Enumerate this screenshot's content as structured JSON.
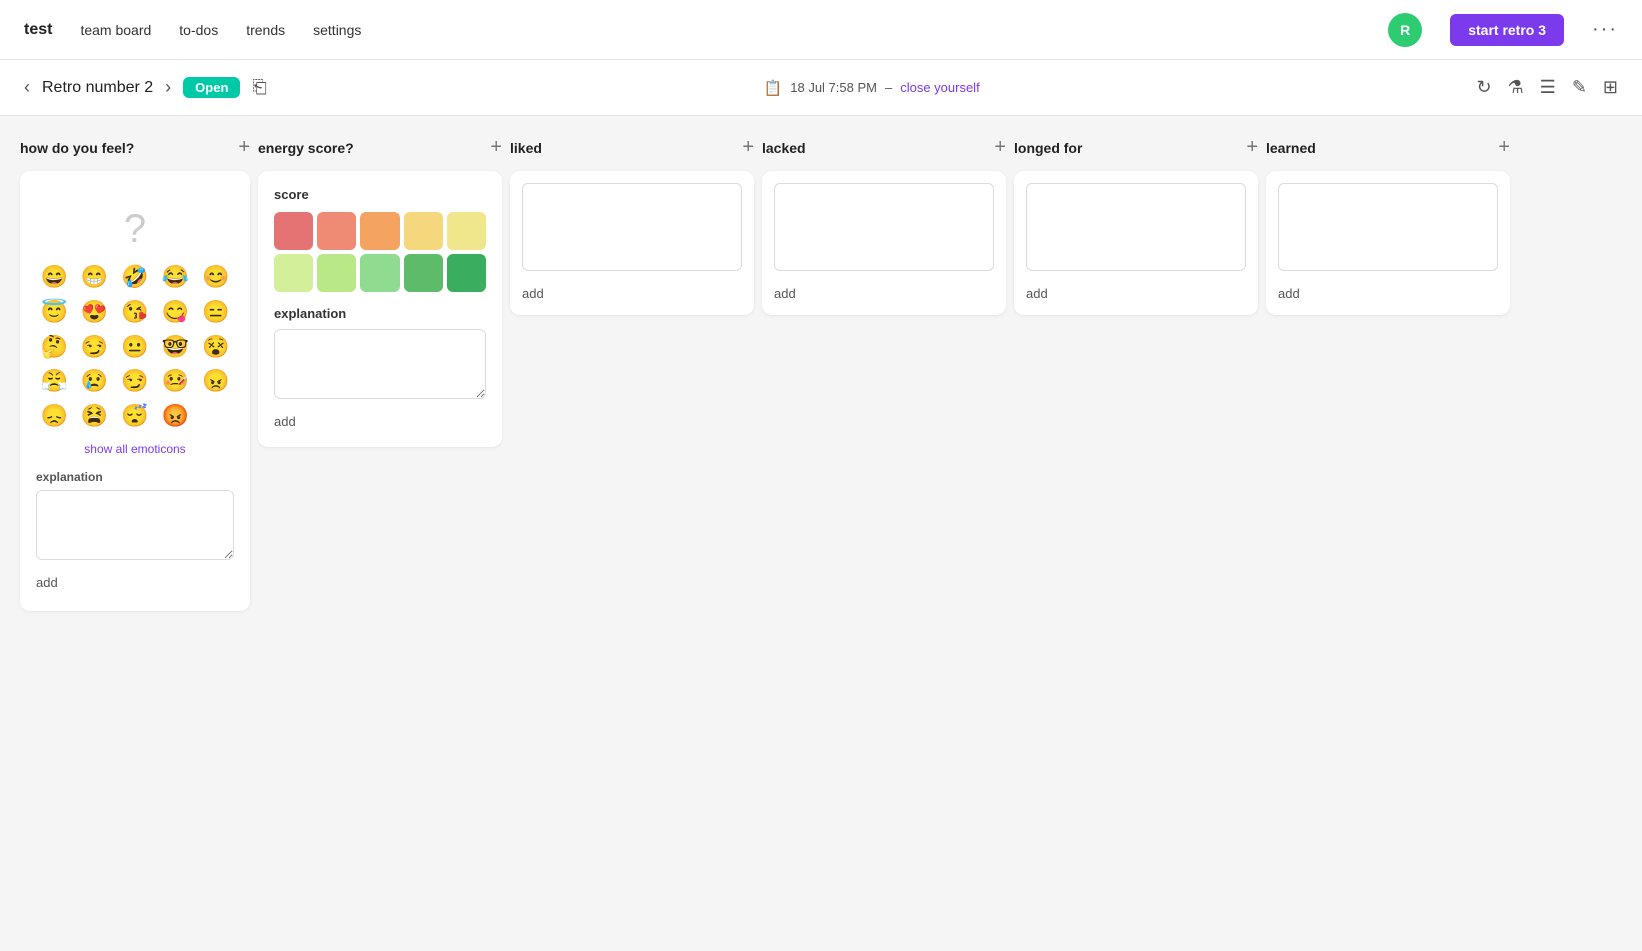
{
  "app": {
    "logo": "test",
    "nav_items": [
      "team board",
      "to-dos",
      "trends",
      "settings"
    ],
    "avatar_letter": "R",
    "start_retro_label": "start retro 3",
    "more_label": "···"
  },
  "sub_nav": {
    "retro_title": "Retro number 2",
    "open_label": "Open",
    "datetime": "18 Jul 7:58 PM",
    "close_label": "close yourself"
  },
  "columns": [
    {
      "id": "feel",
      "title": "how do you feel?",
      "show_all_label": "show all emoticons",
      "explanation_label": "explanation",
      "add_label": "add",
      "emojis": [
        "😄",
        "😁",
        "🤣",
        "😂",
        "😊",
        "😇",
        "😍",
        "😘",
        "😋",
        "😑",
        "🤔",
        "😏",
        "😐",
        "🤓",
        "😵",
        "😤",
        "😢",
        "😏",
        "🤒",
        "😠",
        "😞",
        "😫",
        "😴",
        "😡"
      ]
    },
    {
      "id": "energy",
      "title": "energy score?",
      "score_label": "score",
      "score_colors": [
        "#e57373",
        "#ef8b74",
        "#f4a460",
        "#f5d87e",
        "#f0e68c",
        "#d4ef9a",
        "#b8e986",
        "#8fdb8f",
        "#5dbb6a",
        "#3aad5e"
      ],
      "explanation_label": "explanation",
      "add_label": "add"
    },
    {
      "id": "liked",
      "title": "liked",
      "add_label": "add"
    },
    {
      "id": "lacked",
      "title": "lacked",
      "add_label": "add"
    },
    {
      "id": "longed_for",
      "title": "longed for",
      "add_label": "add"
    },
    {
      "id": "learned",
      "title": "learned",
      "add_label": "add"
    }
  ]
}
